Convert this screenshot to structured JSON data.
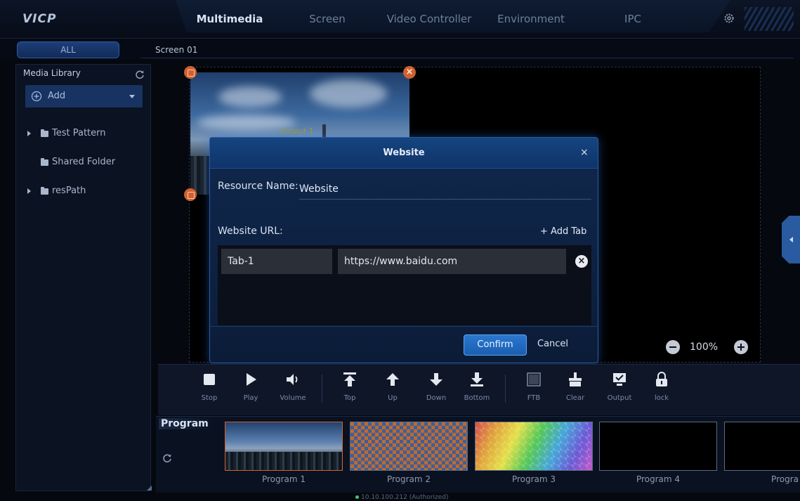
{
  "app": {
    "logo": "VICP"
  },
  "nav": {
    "tabs": [
      {
        "label": "Multimedia",
        "active": true
      },
      {
        "label": "Screen",
        "active": false
      },
      {
        "label": "Video Controller",
        "active": false
      },
      {
        "label": "Environment",
        "active": false
      },
      {
        "label": "IPC",
        "active": false
      }
    ],
    "settings_icon": "gear-icon"
  },
  "filter": {
    "all_label": "ALL",
    "screen_label": "Screen 01"
  },
  "sidebar": {
    "title": "Media Library",
    "add_label": "Add",
    "items": [
      {
        "label": "Test Pattern",
        "expandable": true
      },
      {
        "label": "Shared Folder",
        "expandable": false
      },
      {
        "label": "resPath",
        "expandable": true
      }
    ]
  },
  "canvas": {
    "output_label": "Output 1"
  },
  "zoom": {
    "value": "100%"
  },
  "dialog": {
    "title": "Website",
    "close": "×",
    "resource_name_label": "Resource Name:",
    "resource_name_value": "Website",
    "url_label": "Website URL:",
    "add_tab_label": "+ Add Tab",
    "tabs": [
      {
        "name": "Tab-1",
        "url": "https://www.baidu.com"
      }
    ],
    "confirm_label": "Confirm",
    "cancel_label": "Cancel"
  },
  "toolbar": {
    "tools": [
      {
        "label": "Stop",
        "icon": "stop-icon"
      },
      {
        "label": "Play",
        "icon": "play-icon"
      },
      {
        "label": "Volume",
        "icon": "volume-icon"
      },
      {
        "label": "Top",
        "icon": "arrow-top-icon"
      },
      {
        "label": "Up",
        "icon": "arrow-up-icon"
      },
      {
        "label": "Down",
        "icon": "arrow-down-icon"
      },
      {
        "label": "Bottom",
        "icon": "arrow-bottom-icon"
      },
      {
        "label": "FTB",
        "icon": "ftb-icon"
      },
      {
        "label": "Clear",
        "icon": "clear-icon"
      },
      {
        "label": "Output",
        "icon": "output-icon"
      },
      {
        "label": "lock",
        "icon": "lock-icon"
      }
    ]
  },
  "program": {
    "title": "Program",
    "cards": [
      {
        "label": "Program 1",
        "thumbnail": "city"
      },
      {
        "label": "Program 2",
        "thumbnail": "checker"
      },
      {
        "label": "Program 3",
        "thumbnail": "rainbow"
      },
      {
        "label": "Program 4",
        "thumbnail": "empty"
      },
      {
        "label": "Progra",
        "thumbnail": "empty"
      }
    ]
  },
  "status": {
    "text": "10.10.100.212 (Authorized)"
  },
  "colors": {
    "accent": "#2a78cf",
    "selection": "#d0612f",
    "background": "#05080f"
  }
}
